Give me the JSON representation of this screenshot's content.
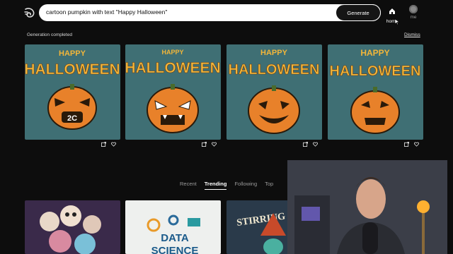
{
  "prompt": {
    "value": "cartoon pumpkin with text \"Happy Halloween\""
  },
  "generate_label": "Generate",
  "nav": {
    "home_label": "home",
    "me_label": "me"
  },
  "status": {
    "text": "Generation completed",
    "dismiss_label": "Dismiss"
  },
  "cards": [
    {
      "text_top": "HAPPY",
      "text_bottom": "HALLOWEEN",
      "pumpkin_text": "2C"
    },
    {
      "text_top": "HAPPY",
      "text_bottom": "HALLOWEEN"
    },
    {
      "text_top": "HAPPY",
      "text_bottom": "HALLOWEEN"
    },
    {
      "text_top": "HAPPY",
      "text_bottom": "HALLOWEEN"
    }
  ],
  "tabs": [
    {
      "label": "Recent",
      "active": false
    },
    {
      "label": "Trending",
      "active": true
    },
    {
      "label": "Following",
      "active": false
    },
    {
      "label": "Top",
      "active": false
    }
  ],
  "thumbs": [
    {
      "text": ""
    },
    {
      "text_top": "DATA",
      "text_bottom": "SCIENCE"
    },
    {
      "text_top": "STIRRING PO"
    }
  ],
  "colors": {
    "card_bg": "#3f6f74",
    "pumpkin": "#e8812a",
    "text_yellow": "#f2b63a",
    "page_bg": "#0d0d0d"
  }
}
